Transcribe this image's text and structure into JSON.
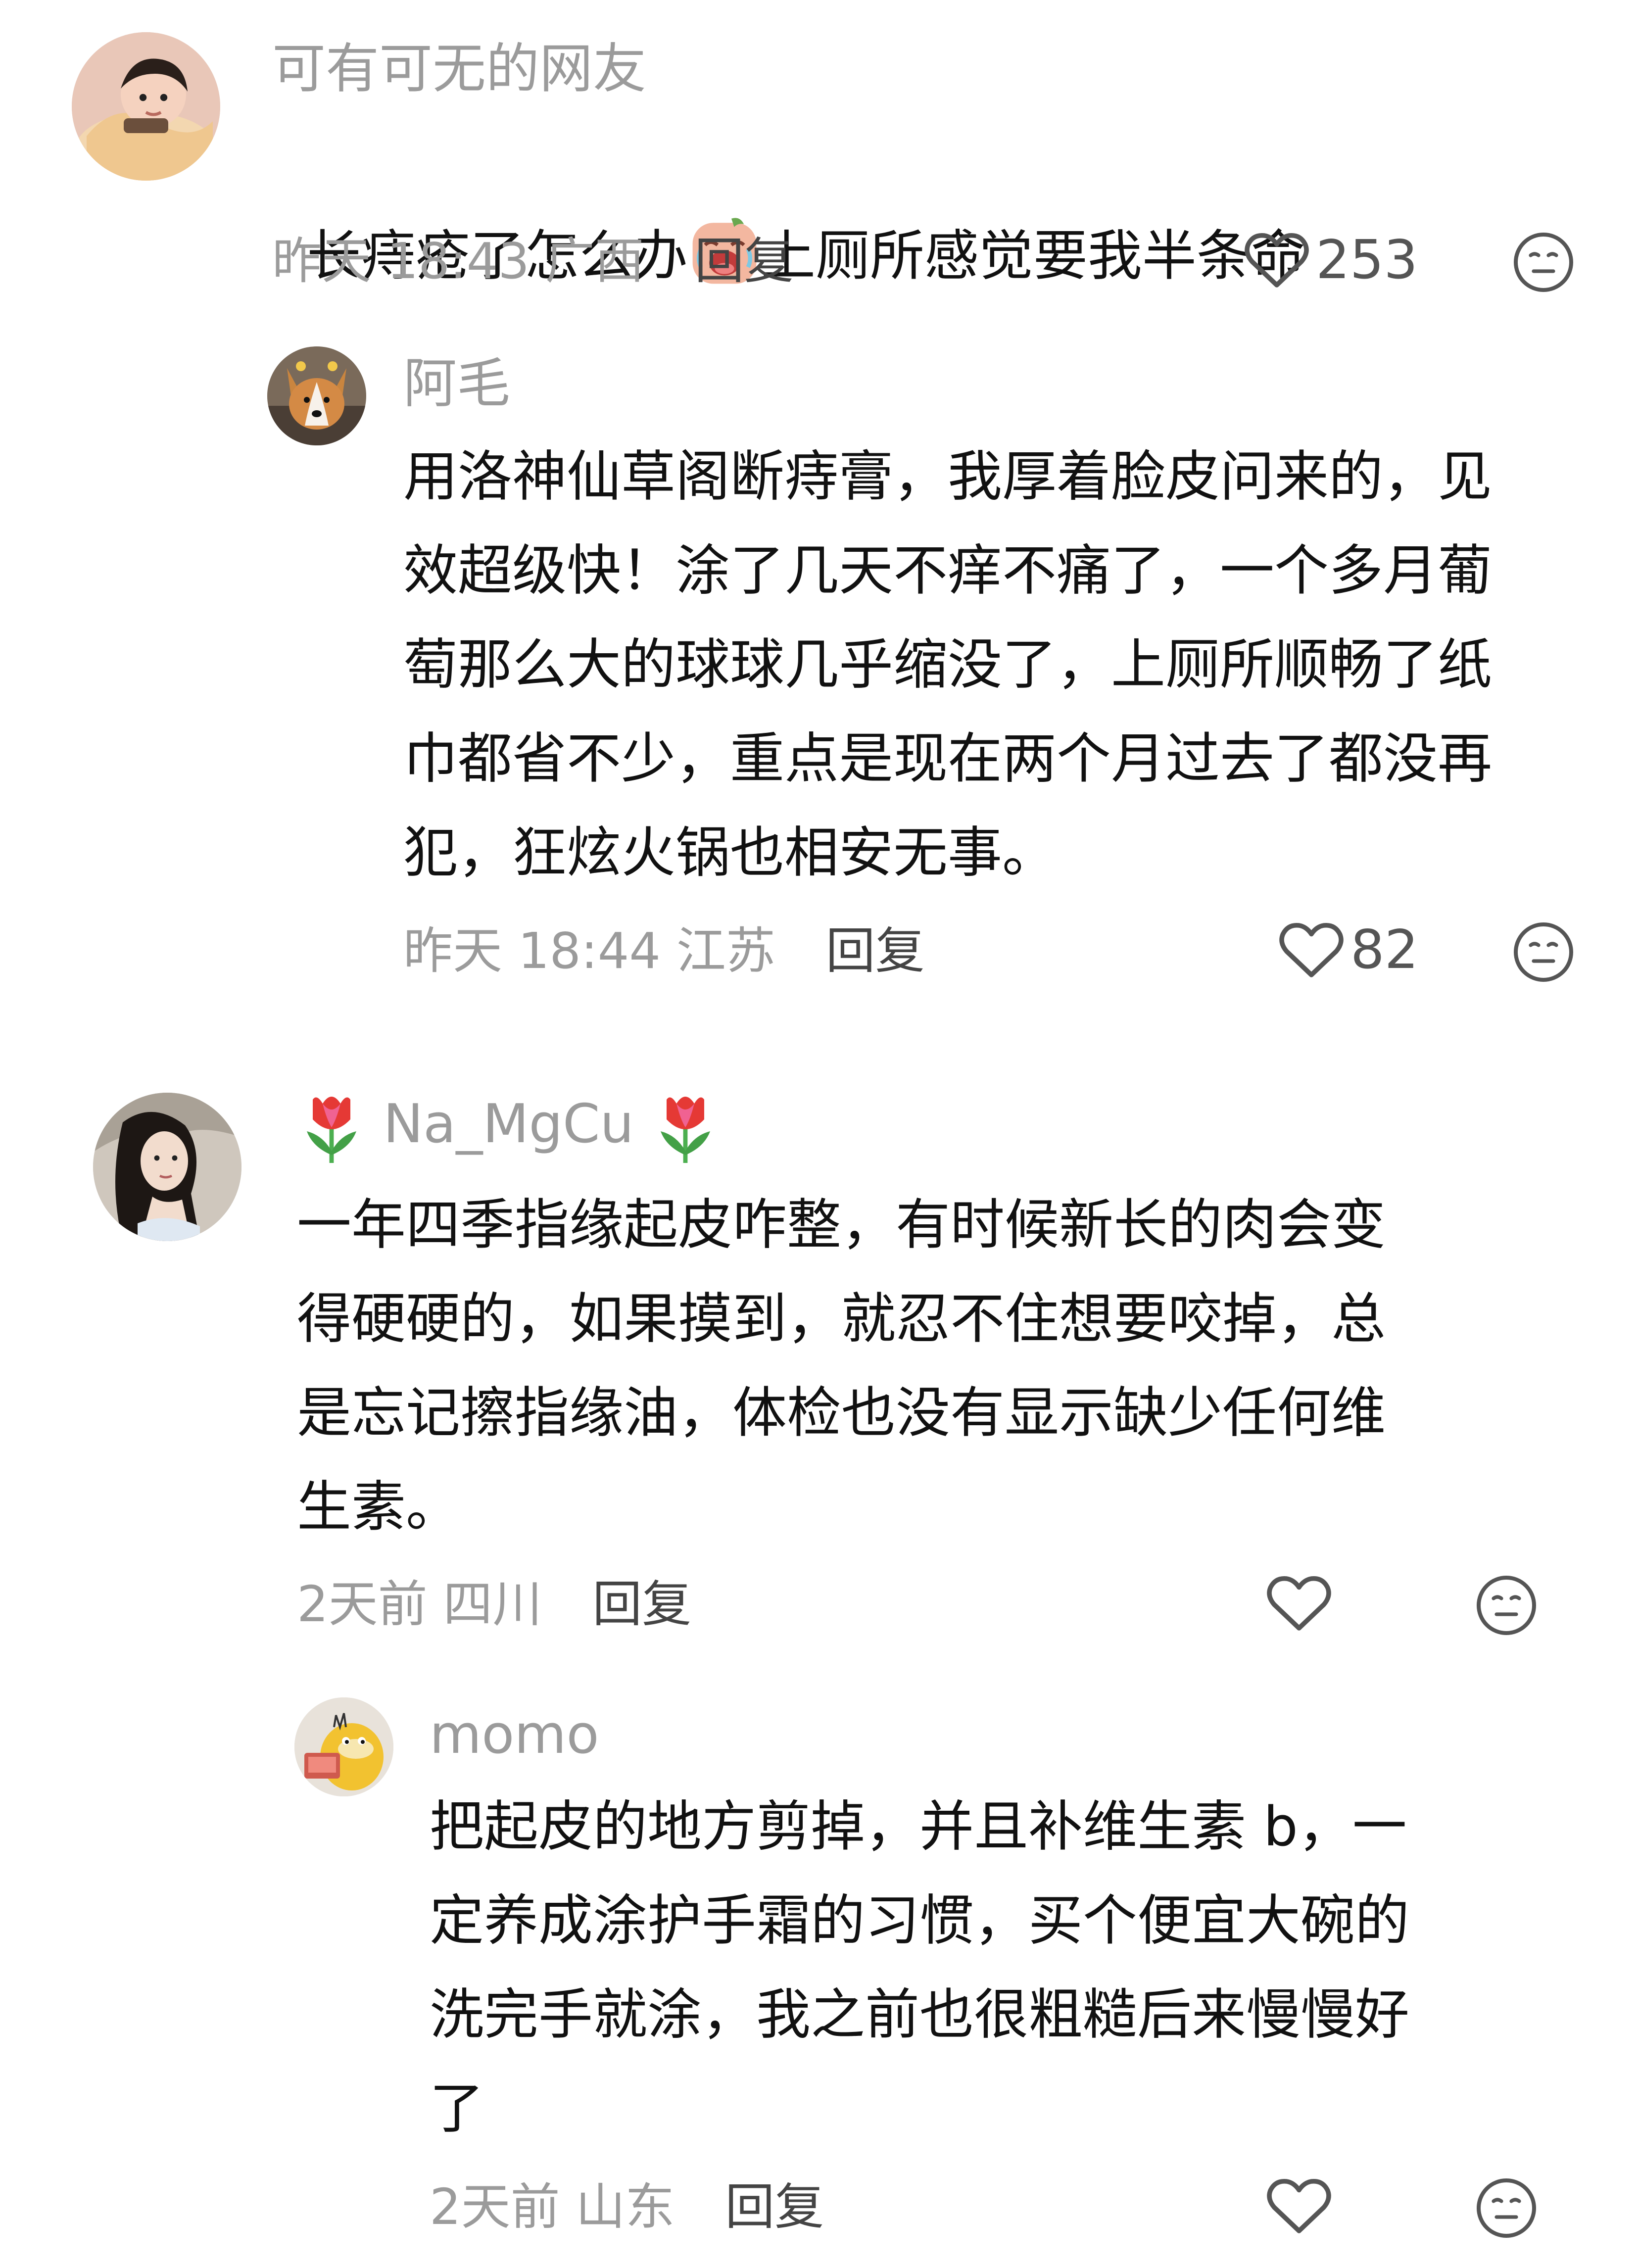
{
  "comments": [
    {
      "username": "可有可无的网友",
      "text_before_emoji": "长痔疮了怎么办",
      "emoji": "crying-face-emoji",
      "text_after_emoji": "上厕所感觉要我半条命",
      "time": "昨天 18:43",
      "location": "广西",
      "reply_label": "回复",
      "likes": "253",
      "avatar_icon": "baby-avatar",
      "replies": [
        {
          "username": "阿毛",
          "text": "用洛神仙草阁断痔膏，我厚着脸皮问来的，见\n效超级快！涂了几天不痒不痛了，一个多月葡\n萄那么大的球球几乎缩没了，上厕所顺畅了纸\n巾都省不少，重点是现在两个月过去了都没再\n犯，狂炫火锅也相安无事。",
          "time": "昨天 18:44",
          "location": "江苏",
          "reply_label": "回复",
          "likes": "82",
          "avatar_icon": "dog-avatar"
        }
      ]
    },
    {
      "username": "Na_MgCu",
      "username_decoration": "tulip-emoji",
      "text": "一年四季指缘起皮咋整，有时候新长的肉会变\n得硬硬的，如果摸到，就忍不住想要咬掉，总\n是忘记擦指缘油，体检也没有显示缺少任何维\n生素。",
      "time": "2天前",
      "location": "四川",
      "reply_label": "回复",
      "likes": "",
      "avatar_icon": "woman-avatar",
      "replies": [
        {
          "username": "momo",
          "text": "把起皮的地方剪掉，并且补维生素 b，一\n定养成涂护手霜的习惯，买个便宜大碗的\n洗完手就涂，我之前也很粗糙后来慢慢好\n了",
          "time": "2天前",
          "location": "山东",
          "reply_label": "回复",
          "likes": "",
          "avatar_icon": "duck-avatar"
        }
      ]
    }
  ],
  "icons": {
    "like": "heart-outline-icon",
    "dislike": "neutral-face-icon"
  },
  "colors": {
    "text": "#111111",
    "meta": "#9b9b9b",
    "icon": "#555555"
  }
}
